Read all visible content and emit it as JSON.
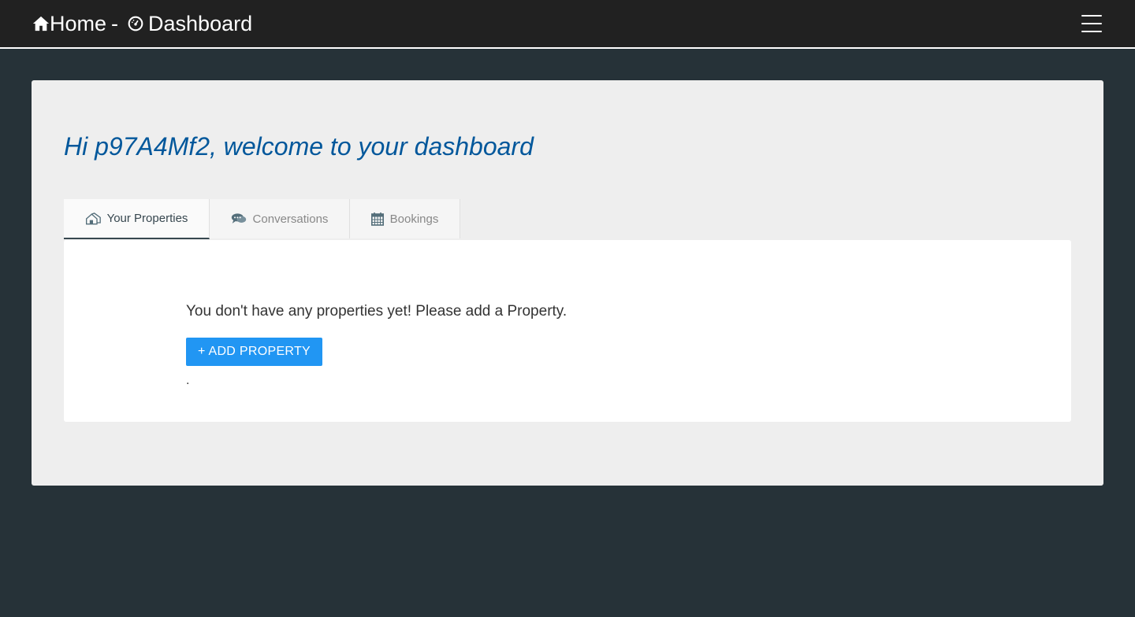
{
  "nav": {
    "home_label": "Home",
    "separator": "-",
    "dashboard_label": "Dashboard",
    "home_icon": "home-icon",
    "dashboard_icon": "dashboard-gauge-icon",
    "menu_icon": "hamburger-menu-icon"
  },
  "welcome": {
    "text": "Hi p97A4Mf2, welcome to your dashboard"
  },
  "tabs": [
    {
      "label": "Your Properties",
      "icon": "properties-house-icon",
      "active": true
    },
    {
      "label": "Conversations",
      "icon": "chat-bubbles-icon",
      "active": false
    },
    {
      "label": "Bookings",
      "icon": "calendar-icon",
      "active": false
    }
  ],
  "properties": {
    "empty_message": "You don't have any properties yet! Please add a Property.",
    "add_button_label": "+ ADD PROPERTY",
    "trailing_text": "."
  },
  "colors": {
    "page_bg": "#263238",
    "topbar_bg": "#212121",
    "panel_bg": "#eeeeee",
    "welcome_text": "#01579b",
    "button_bg": "#2196f3",
    "active_tab_underline": "#37474f"
  }
}
